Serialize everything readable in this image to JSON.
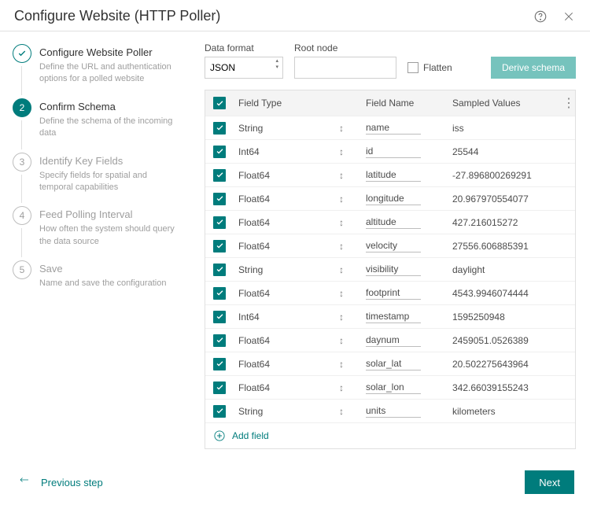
{
  "title": "Configure Website (HTTP Poller)",
  "steps": [
    {
      "num": "",
      "title": "Configure Website Poller",
      "desc": "Define the URL and authentication options for a polled website",
      "state": "done"
    },
    {
      "num": "2",
      "title": "Confirm Schema",
      "desc": "Define the schema of the incoming data",
      "state": "active"
    },
    {
      "num": "3",
      "title": "Identify Key Fields",
      "desc": "Specify fields for spatial and temporal capabilities",
      "state": "pending"
    },
    {
      "num": "4",
      "title": "Feed Polling Interval",
      "desc": "How often the system should query the data source",
      "state": "pending"
    },
    {
      "num": "5",
      "title": "Save",
      "desc": "Name and save the configuration",
      "state": "pending"
    }
  ],
  "controls": {
    "data_format_label": "Data format",
    "data_format_value": "JSON",
    "root_node_label": "Root node",
    "root_node_value": "",
    "flatten_label": "Flatten",
    "derive_label": "Derive schema"
  },
  "table": {
    "head": {
      "field_type": "Field Type",
      "field_name": "Field Name",
      "sampled": "Sampled Values"
    },
    "rows": [
      {
        "type": "String",
        "name": "name",
        "val": "iss"
      },
      {
        "type": "Int64",
        "name": "id",
        "val": "25544"
      },
      {
        "type": "Float64",
        "name": "latitude",
        "val": "-27.896800269291"
      },
      {
        "type": "Float64",
        "name": "longitude",
        "val": "20.967970554077"
      },
      {
        "type": "Float64",
        "name": "altitude",
        "val": "427.216015272"
      },
      {
        "type": "Float64",
        "name": "velocity",
        "val": "27556.606885391"
      },
      {
        "type": "String",
        "name": "visibility",
        "val": "daylight"
      },
      {
        "type": "Float64",
        "name": "footprint",
        "val": "4543.9946074444"
      },
      {
        "type": "Int64",
        "name": "timestamp",
        "val": "1595250948"
      },
      {
        "type": "Float64",
        "name": "daynum",
        "val": "2459051.0526389"
      },
      {
        "type": "Float64",
        "name": "solar_lat",
        "val": "20.502275643964"
      },
      {
        "type": "Float64",
        "name": "solar_lon",
        "val": "342.66039155243"
      },
      {
        "type": "String",
        "name": "units",
        "val": "kilometers"
      }
    ],
    "add_label": "Add field"
  },
  "footer": {
    "prev": "Previous step",
    "next": "Next"
  }
}
